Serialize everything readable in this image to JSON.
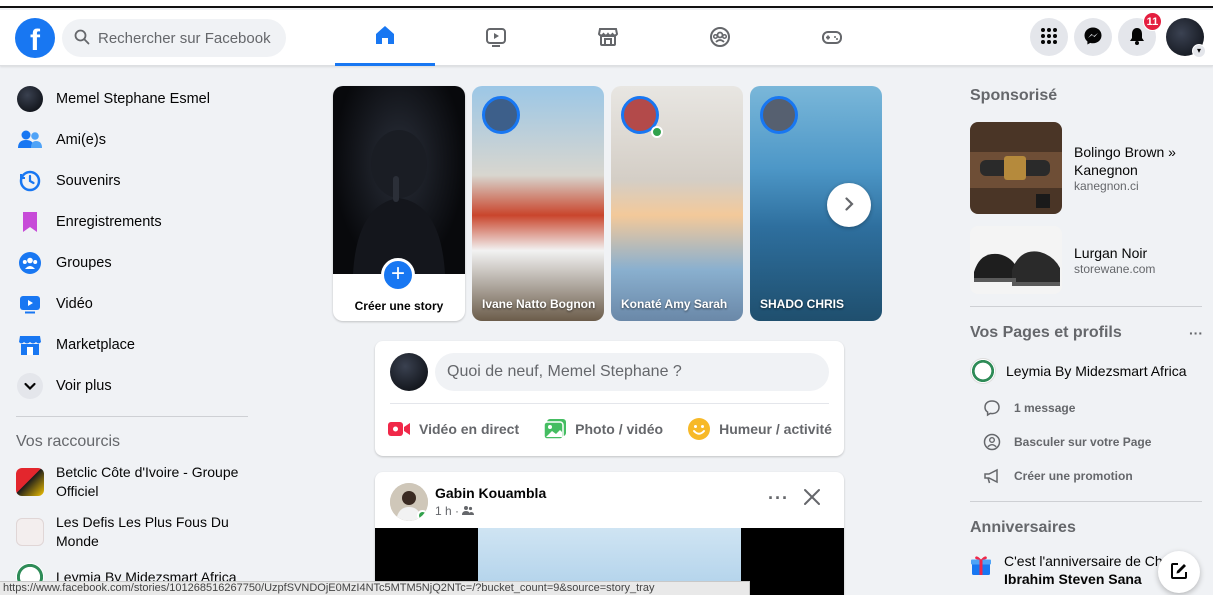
{
  "header": {
    "logo": "f",
    "search_placeholder": "Rechercher sur Facebook",
    "notifications_count": "11"
  },
  "colors": {
    "accent": "#1877f2",
    "badge": "#e41e3f",
    "online": "#31a24c"
  },
  "left": {
    "profile_name": "Memel Stephane Esmel",
    "items": [
      {
        "label": "Ami(e)s",
        "icon": "friends-icon"
      },
      {
        "label": "Souvenirs",
        "icon": "memories-icon"
      },
      {
        "label": "Enregistrements",
        "icon": "saved-icon"
      },
      {
        "label": "Groupes",
        "icon": "groups-icon"
      },
      {
        "label": "Vidéo",
        "icon": "video-icon"
      },
      {
        "label": "Marketplace",
        "icon": "marketplace-icon"
      },
      {
        "label": "Voir plus",
        "icon": "chevron-down-icon"
      }
    ],
    "shortcuts_title": "Vos raccourcis",
    "shortcuts": [
      {
        "label": "Betclic Côte d'Ivoire - Groupe Officiel"
      },
      {
        "label": "Les Defis Les Plus Fous Du Monde"
      },
      {
        "label": "Leymia By Midezsmart Africa"
      }
    ]
  },
  "stories": {
    "create_label": "Créer une story",
    "items": [
      {
        "name": "Ivane Natto Bognon"
      },
      {
        "name": "Konaté Amy Sarah"
      },
      {
        "name": "SHADO CHRIS"
      }
    ]
  },
  "composer": {
    "placeholder": "Quoi de neuf, Memel Stephane ?",
    "actions": [
      {
        "label": "Vidéo en direct"
      },
      {
        "label": "Photo / vidéo"
      },
      {
        "label": "Humeur / activité"
      }
    ]
  },
  "post": {
    "author": "Gabin Kouambla",
    "time": "1 h ·"
  },
  "right": {
    "sponsored_title": "Sponsorisé",
    "ads": [
      {
        "title": "Bolingo Brown » Kanegnon",
        "url": "kanegnon.ci"
      },
      {
        "title": "Lurgan Noir",
        "url": "storewane.com"
      }
    ],
    "pages_title": "Vos Pages et profils",
    "pages_more": "···",
    "page_name": "Leymia By Midezsmart Africa",
    "page_actions": [
      {
        "label": "1 message"
      },
      {
        "label": "Basculer sur votre Page"
      },
      {
        "label": "Créer une promotion"
      }
    ],
    "birthdays_title": "Anniversaires",
    "birthday_text": "C'est l'anniversaire de Ch",
    "birthday_name": "Ibrahim Steven Sana"
  },
  "statusbar": {
    "url": "https://www.facebook.com/stories/101268516267750/UzpfSVNDOjE0MzI4NTc5MTM5NjQ2NTc=/?bucket_count=9&source=story_tray"
  }
}
